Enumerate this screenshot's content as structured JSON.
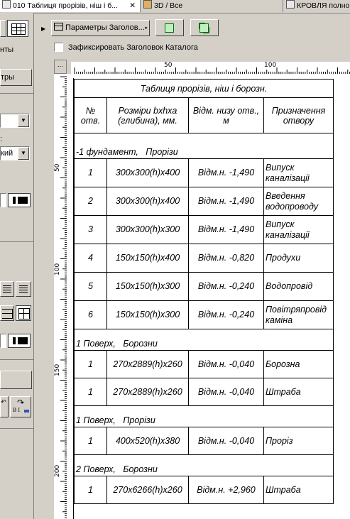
{
  "tabs": [
    {
      "label": "010 Таблиця прорізів, ніш і б...",
      "close": "✕",
      "active": true
    },
    {
      "label": "3D / Все",
      "active": false
    },
    {
      "label": "КРОВЛЯ полно",
      "active": false
    }
  ],
  "sidebar": {
    "text1": "нты",
    "button1": "тры",
    "label_colon": ":",
    "select2_value": "кий"
  },
  "toolbar": {
    "params_label": "Параметры Заголов...",
    "fix_header_label": "Зафиксировать Заголовок Каталога"
  },
  "ruler": {
    "h_labels": [
      "50",
      "100"
    ],
    "v_labels": [
      "50",
      "100",
      "150",
      "200"
    ],
    "corner": "..."
  },
  "schedule": {
    "title": "Таблиця прорізів, ніш і борозн.",
    "headers": [
      "№ отв.",
      "Розміри bxhxa (глибина), мм.",
      "Відм. низу отв., м",
      "Призначення отвору"
    ],
    "groups": [
      {
        "label": "-1 фундамент,   Прорізи",
        "rows": [
          {
            "num": "1",
            "size": "300x300(h)x400",
            "level": "Відм.н. -1,490",
            "purpose": "Випуск каналізації"
          },
          {
            "num": "2",
            "size": "300x300(h)x400",
            "level": "Відм.н. -1,490",
            "purpose": "Введення водопроводу"
          },
          {
            "num": "3",
            "size": "300x300(h)x300",
            "level": "Відм.н. -1,490",
            "purpose": "Випуск каналізації"
          },
          {
            "num": "4",
            "size": "150x150(h)x400",
            "level": "Відм.н. -0,820",
            "purpose": "Продухи"
          },
          {
            "num": "5",
            "size": "150x150(h)x300",
            "level": "Відм.н. -0,240",
            "purpose": "Водопровід"
          },
          {
            "num": "6",
            "size": "150x150(h)x300",
            "level": "Відм.н. -0,240",
            "purpose": "Повітряпровід каміна"
          }
        ]
      },
      {
        "label": "1 Поверх,   Борозни",
        "rows": [
          {
            "num": "1",
            "size": "270x2889(h)x260",
            "level": "Відм.н. -0,040",
            "purpose": "Борозна"
          },
          {
            "num": "1",
            "size": "270x2889(h)x260",
            "level": "Відм.н. -0,040",
            "purpose": "Штраба"
          }
        ]
      },
      {
        "label": "1 Поверх,   Прорізи",
        "rows": [
          {
            "num": "1",
            "size": "400x520(h)x380",
            "level": "Відм.н. -0,040",
            "purpose": "Проріз"
          }
        ]
      },
      {
        "label": "2 Поверх,   Борозни",
        "rows": [
          {
            "num": "1",
            "size": "270x6266(h)x260",
            "level": "Відм.н. +2,960",
            "purpose": "Штраба"
          }
        ]
      }
    ]
  }
}
